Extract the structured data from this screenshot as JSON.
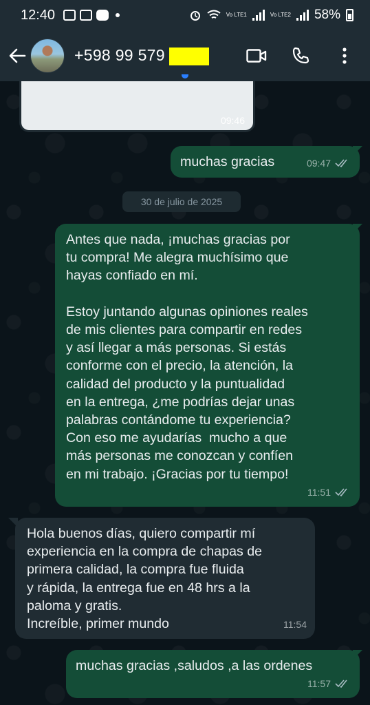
{
  "status_bar": {
    "time": "12:40",
    "network_1": "Vo LTE1",
    "network_2": "Vo LTE2",
    "battery": "58%"
  },
  "header": {
    "contact_name": "+598 99 579",
    "icons": [
      "back-arrow-icon",
      "video-call-icon",
      "voice-call-icon",
      "more-options-icon"
    ]
  },
  "messages": [
    {
      "type": "image",
      "direction": "in",
      "time": "09:46"
    },
    {
      "type": "text",
      "direction": "out",
      "text": "muchas gracias",
      "time": "09:47",
      "status": "read"
    },
    {
      "type": "date",
      "text": "30 de julio de 2025"
    },
    {
      "type": "text",
      "direction": "out",
      "time": "11:51",
      "status": "read",
      "lines": [
        "Antes que nada, ¡muchas gracias por",
        "tu compra! Me alegra muchísimo que",
        "hayas confiado en mí.",
        "",
        "Estoy juntando algunas opiniones reales",
        "de mis clientes para compartir en redes",
        "y así llegar a más personas. Si estás",
        "conforme con el precio, la atención, la",
        "calidad del producto y la puntualidad",
        "en la entrega, ¿me podrías dejar unas",
        "palabras contándome tu experiencia?",
        "Con eso me ayudarías  mucho a que",
        "más personas me conozcan y confíen",
        "en mi trabajo. ¡Gracias por tu tiempo!"
      ]
    },
    {
      "type": "text",
      "direction": "in",
      "time": "11:54",
      "lines": [
        "Hola buenos días, quiero compartir mí",
        "experiencia en la compra de chapas de",
        "primera calidad, la compra fue fluida",
        "y rápida, la entrega fue en 48 hrs a la",
        "paloma y gratis.",
        "Increíble, primer mundo"
      ]
    },
    {
      "type": "text",
      "direction": "out",
      "text": "muchas gracias ,saludos ,a las ordenes",
      "time": "11:57",
      "status": "read"
    }
  ],
  "colors": {
    "outgoing_bubble": "#144d37",
    "incoming_bubble": "#202c33",
    "background": "#0b141a",
    "header": "#1f2c34",
    "redaction": "#ffff00"
  }
}
